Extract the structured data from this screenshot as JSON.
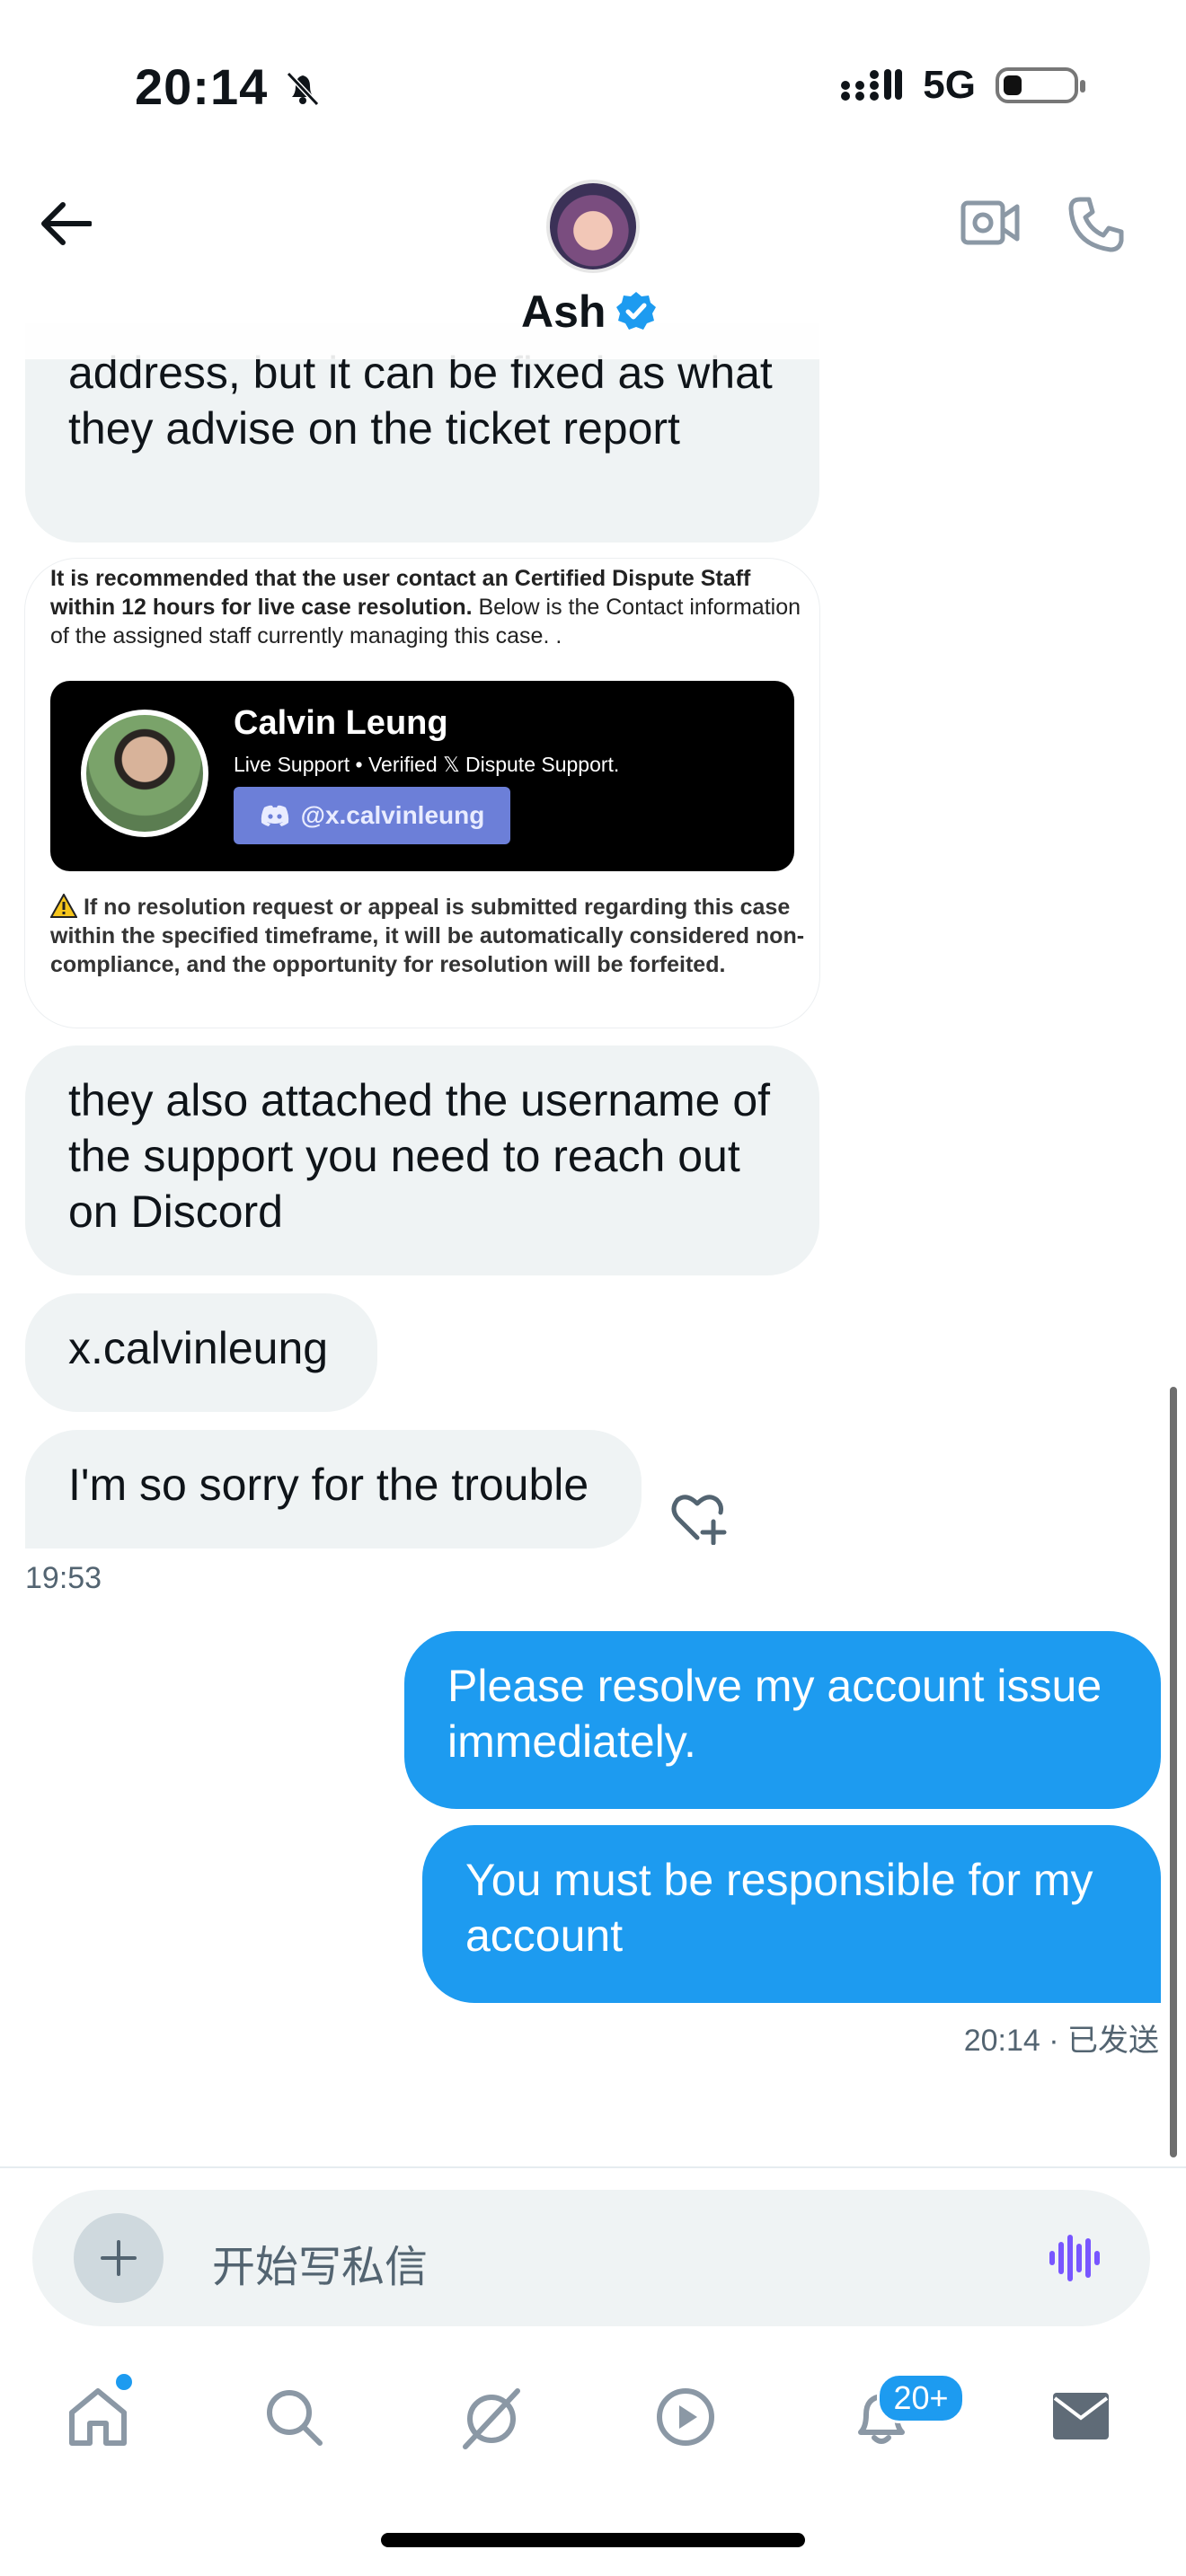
{
  "status_bar": {
    "time": "20:14",
    "network": "5G",
    "icons": [
      "bell-slash-icon",
      "signal-icon",
      "battery-icon"
    ]
  },
  "header": {
    "back_icon": "arrow-left-icon",
    "name": "Ash",
    "verified_icon": "verified-badge-icon",
    "video_icon": "video-call-icon",
    "phone_icon": "phone-icon"
  },
  "messages": [
    {
      "from": "them",
      "text": "address, but it can be fixed as what they advise on the ticket report"
    },
    {
      "from": "them",
      "type": "image",
      "image": {
        "top_text_bold": "It is recommended that the user contact an Certified Dispute Staff within 12 hours for live case resolution.",
        "top_text": " Below is the Contact information of the assigned staff currently managing this case. .",
        "staff_name": "Calvin Leung",
        "staff_sub": "Live Support • Verified 𝕏 Dispute Support.",
        "discord_handle": "@x.calvinleung",
        "warning": "If no resolution request or appeal is submitted regarding this case within the specified timeframe, it will be automatically considered non-compliance, and the opportunity for resolution will be forfeited."
      }
    },
    {
      "from": "them",
      "text": "they also attached the username of the support you need to reach out on Discord"
    },
    {
      "from": "them",
      "text": "x.calvinleung"
    },
    {
      "from": "them",
      "text": "I'm so sorry for the trouble"
    },
    {
      "from": "me",
      "text": "Please resolve my account issue immediately."
    },
    {
      "from": "me",
      "text": "You must be responsible for my account"
    }
  ],
  "timestamps": {
    "them_last": "19:53",
    "me_last": "20:14 · 已发送"
  },
  "composer": {
    "placeholder": "开始写私信",
    "plus_icon": "plus-icon",
    "voice_icon": "voice-waveform-icon"
  },
  "bottom_nav": {
    "items": [
      "home-icon",
      "search-icon",
      "grok-icon",
      "video-play-icon",
      "notifications-bell-icon",
      "messages-envelope-icon"
    ],
    "notification_badge": "20+"
  },
  "colors": {
    "accent": "#1d9bf0",
    "incoming_bubble": "#eff3f4",
    "muted_text": "#536471"
  }
}
